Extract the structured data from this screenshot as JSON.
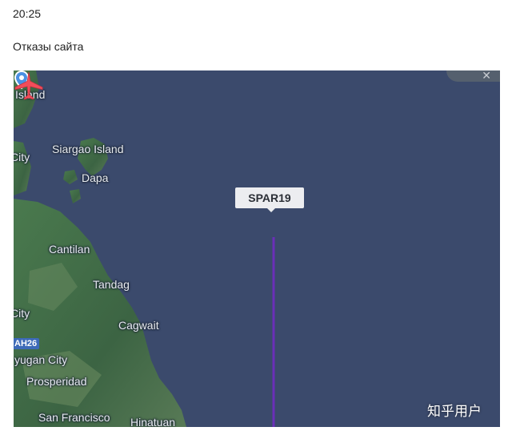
{
  "header": {
    "time": "20:25",
    "caption": "Отказы сайта"
  },
  "map": {
    "places": {
      "island": "Island",
      "city_top": "City",
      "siargao": "Siargao Island",
      "dapa": "Dapa",
      "cantilan": "Cantilan",
      "tandag": "Tandag",
      "city_mid": "City",
      "cagwait": "Cagwait",
      "bayugan": "yugan City",
      "prosperidad": "Prosperidad",
      "san_francisco": "San Francisco",
      "hinatuan": "Hinatuan"
    },
    "road_label": "AH26",
    "flight": {
      "callsign": "SPAR19",
      "plane_color": "#f24d5a",
      "track_color": "#6a2fb8"
    },
    "pin_icon": "location-pin-icon",
    "ocean_color": "#3b4a6c",
    "land_color": "#3e6a45"
  },
  "watermark": "知乎用户"
}
